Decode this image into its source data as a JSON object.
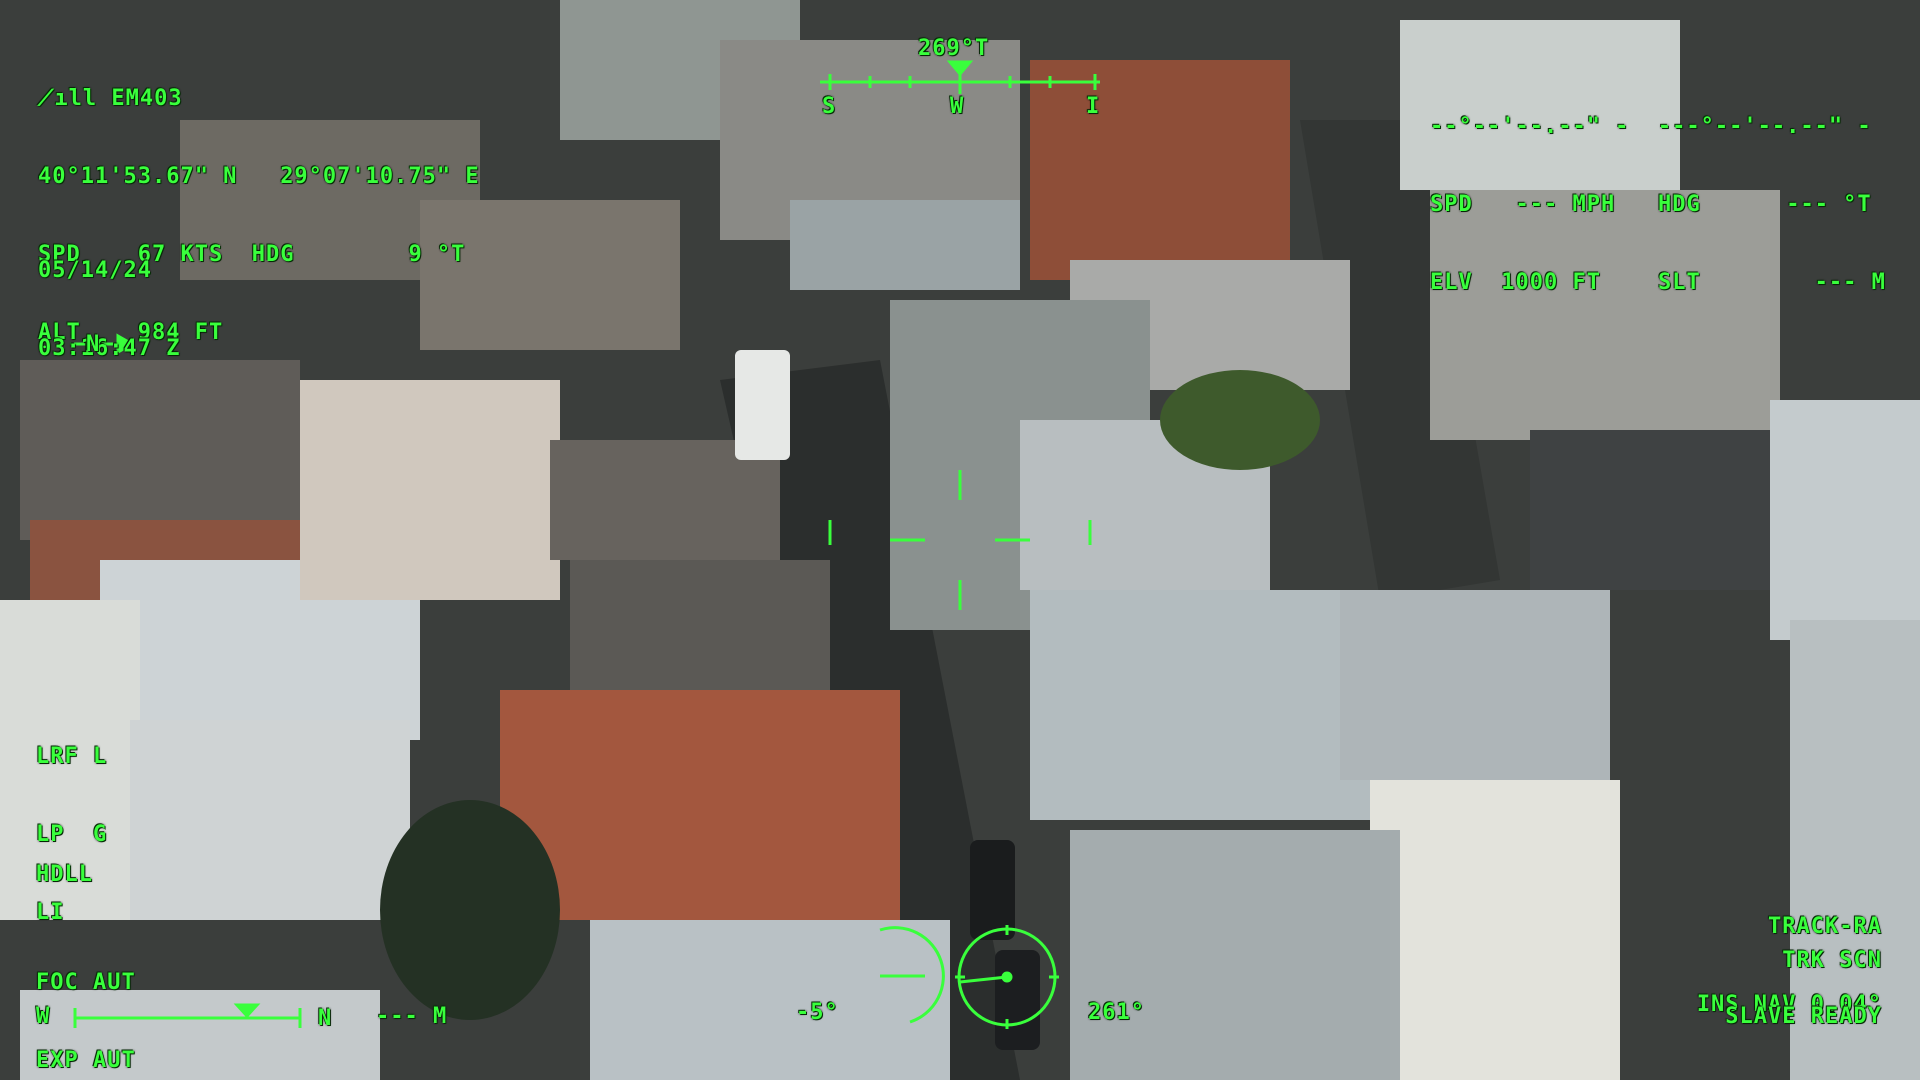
{
  "hud_color": "#39ff3c",
  "top_left": {
    "signal_icon": "satellite-antenna-icon",
    "callsign": "EM403",
    "lat": "40°11'53.67\" N",
    "lon": "29°07'10.75\" E",
    "spd_label": "SPD",
    "spd_value": "67 KTS",
    "hdg_label": "HDG",
    "hdg_value": "9 °T",
    "alt_label": "ALT",
    "alt_value": "984 FT",
    "date": "05/14/24",
    "time": "03:16:47 Z",
    "north_arrow": "—N→"
  },
  "top_center": {
    "heading": "269°T",
    "tape_labels": [
      "S",
      "W",
      "I"
    ]
  },
  "top_right": {
    "coords": "--°--'--.--\" -  ---°--'--.--\" -",
    "spd_label": "SPD",
    "spd_value": "--- MPH",
    "hdg_label": "HDG",
    "hdg_value": "--- °T",
    "elv_label": "ELV",
    "elv_value": "1000 FT",
    "slt_label": "SLT",
    "slt_value": "--- M"
  },
  "left_mid": {
    "lrf": "LRF L",
    "lp": "LP  G",
    "li": "LI",
    "hdll": "HDLL",
    "foc": "FOC AUT",
    "exp": "EXP AUT"
  },
  "bottom_left": {
    "scale_w": "W",
    "scale_n": "N",
    "range": "--- M"
  },
  "bottom_center": {
    "elevation_angle": "-5°",
    "azimuth": "261°"
  },
  "right_bottom": {
    "track": "TRACK-RA",
    "ins": "INS NAV 0.04°",
    "trk": "TRK SCN",
    "slave": "SLAVE READY"
  }
}
